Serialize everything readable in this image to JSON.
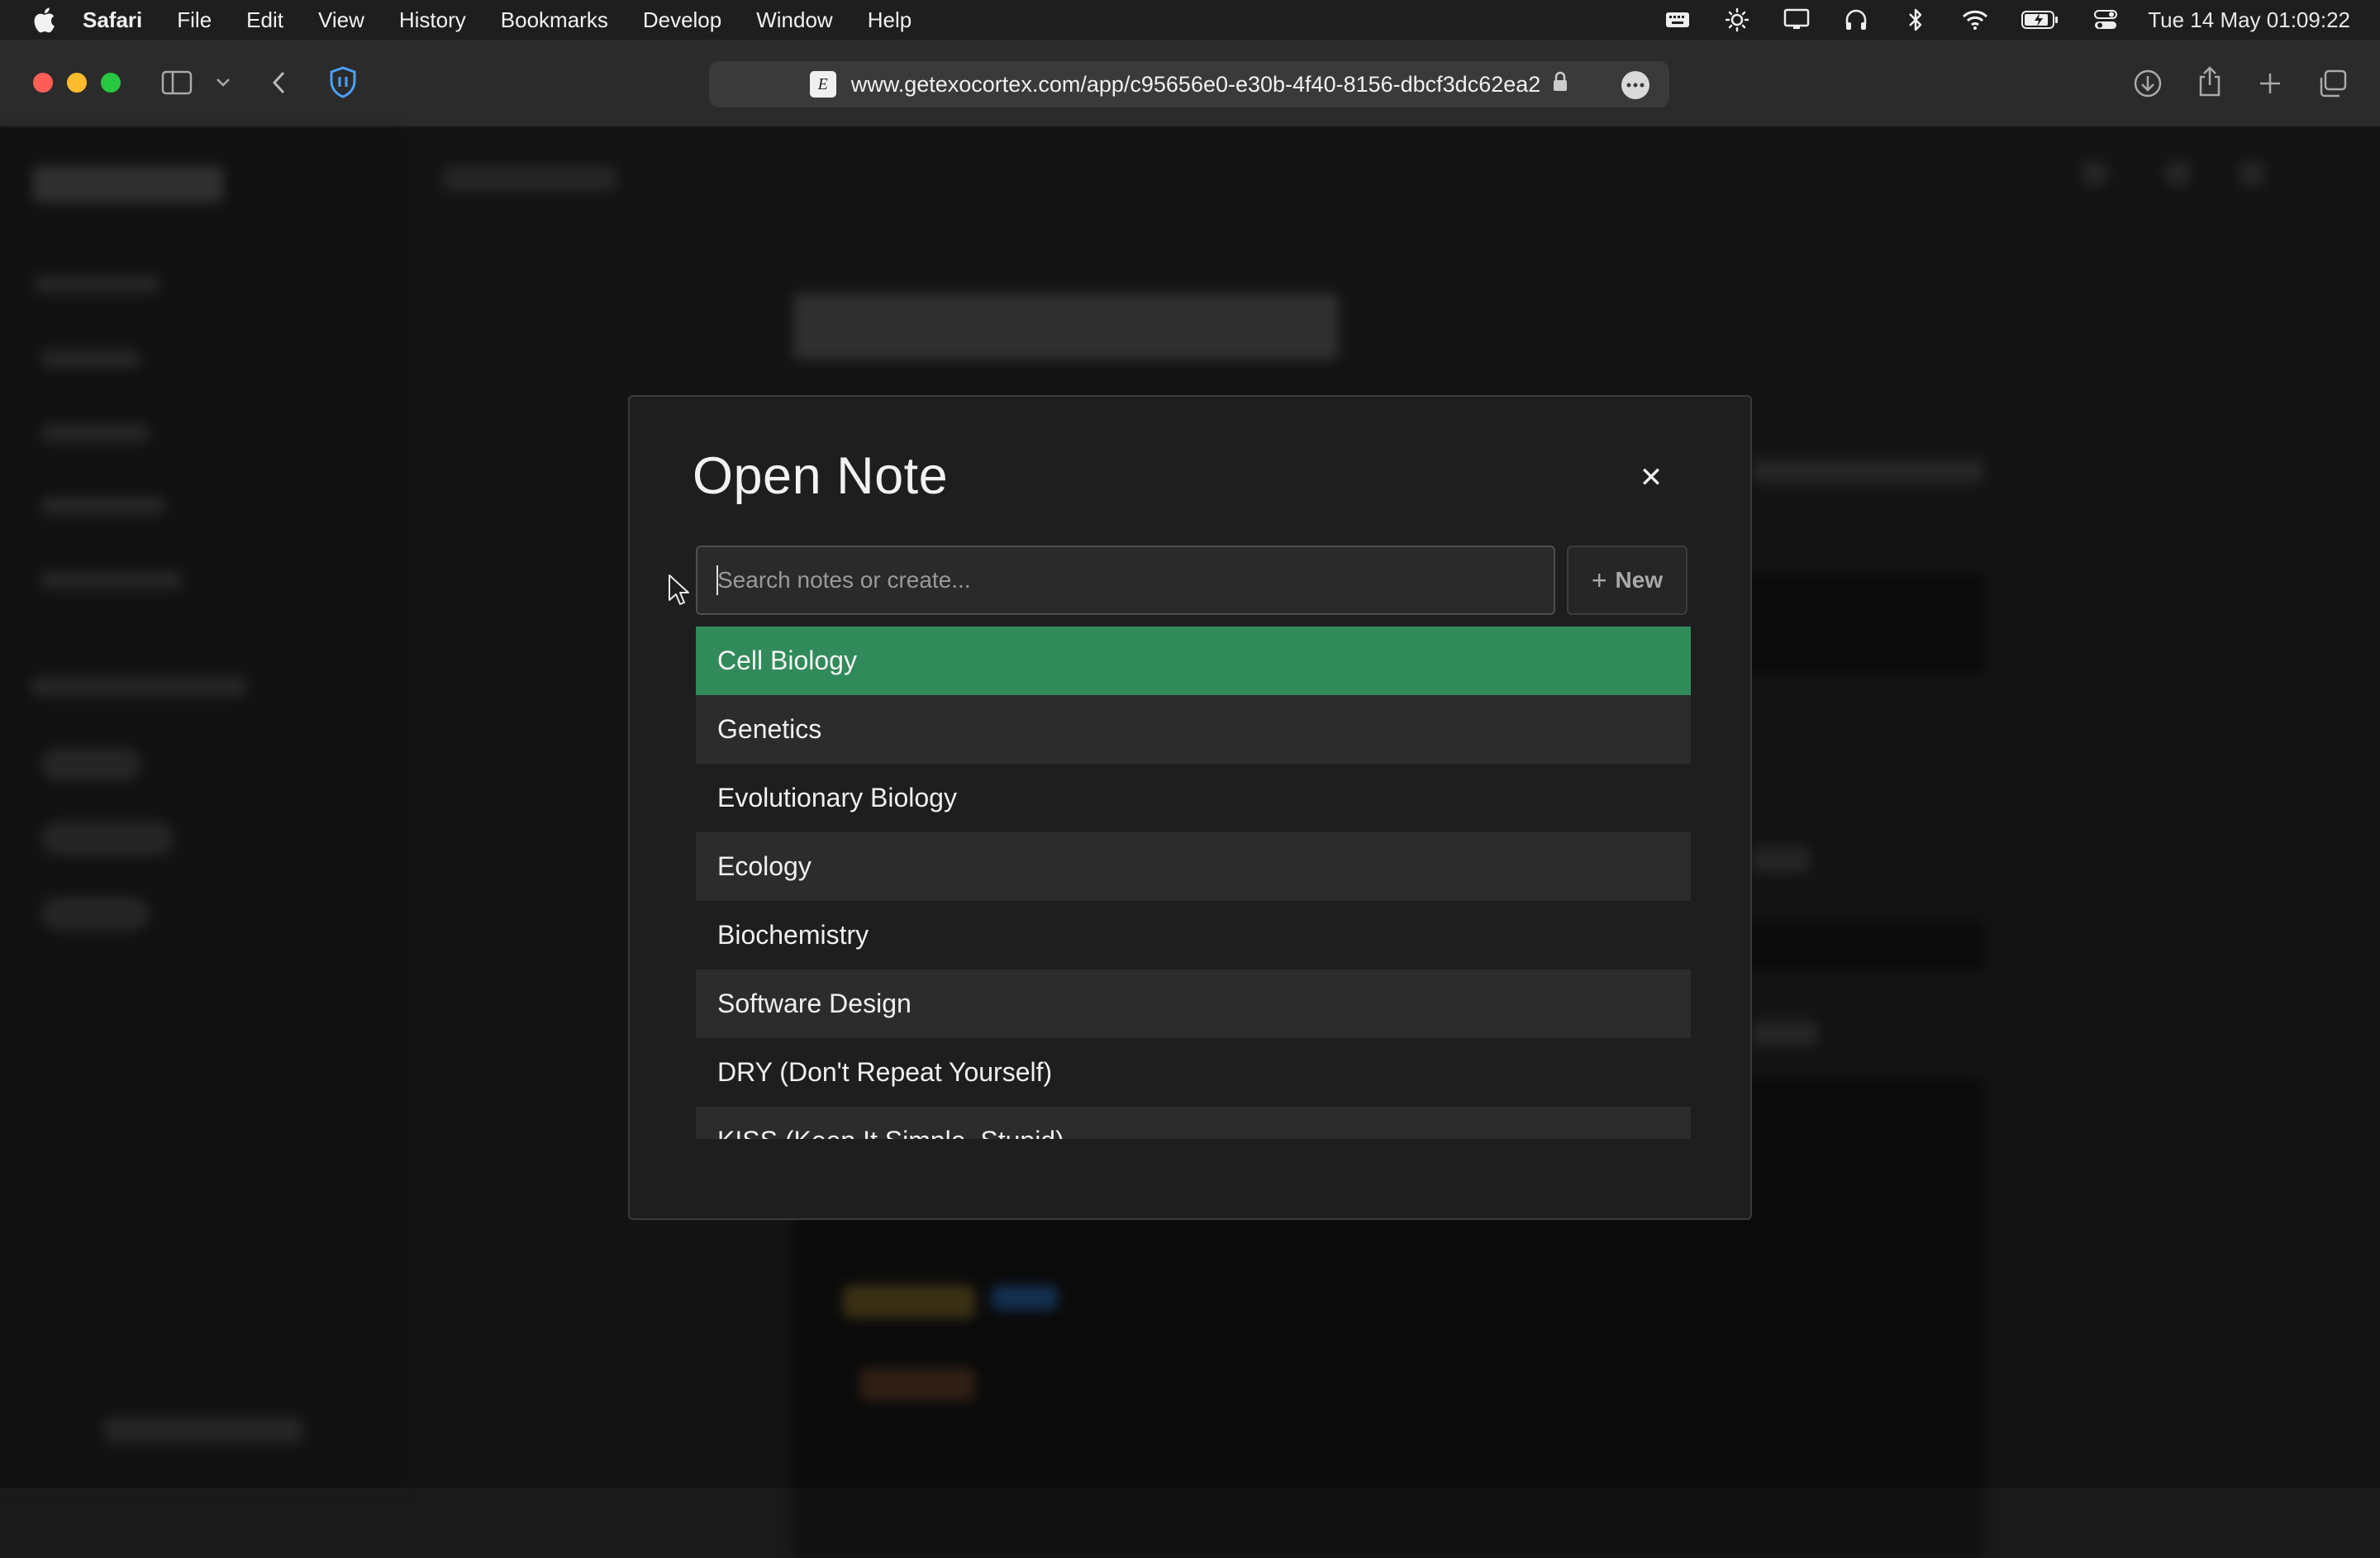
{
  "menubar": {
    "app_name": "Safari",
    "items": [
      "File",
      "Edit",
      "View",
      "History",
      "Bookmarks",
      "Develop",
      "Window",
      "Help"
    ],
    "clock": "Tue 14 May  01:09:22",
    "status_icons": [
      "keyboard-icon",
      "brightness-icon",
      "display-icon",
      "headphones-icon",
      "bluetooth-icon",
      "wifi-icon",
      "battery-icon",
      "control-center-icon"
    ]
  },
  "browser": {
    "url": "www.getexocortex.com/app/c95656e0-e30b-4f40-8156-dbcf3dc62ea2",
    "favicon_letter": "E"
  },
  "modal": {
    "title": "Open Note",
    "search_placeholder": "Search notes or create...",
    "new_label": "New",
    "new_icon": "+",
    "close_icon": "✕",
    "notes": [
      "Cell Biology",
      "Genetics",
      "Evolutionary Biology",
      "Ecology",
      "Biochemistry",
      "Software Design",
      "DRY (Don't Repeat Yourself)",
      "KISS (Keep It Simple, Stupid)"
    ],
    "selected_index": 0
  },
  "colors": {
    "accent_green": "#318a5a",
    "modal_bg": "#1e1e1e",
    "row_alt": "#2c2c2c",
    "traffic_red": "#ff5f57",
    "traffic_yellow": "#febc2e",
    "traffic_green": "#28c840",
    "shield_blue": "#4aa3ff"
  }
}
